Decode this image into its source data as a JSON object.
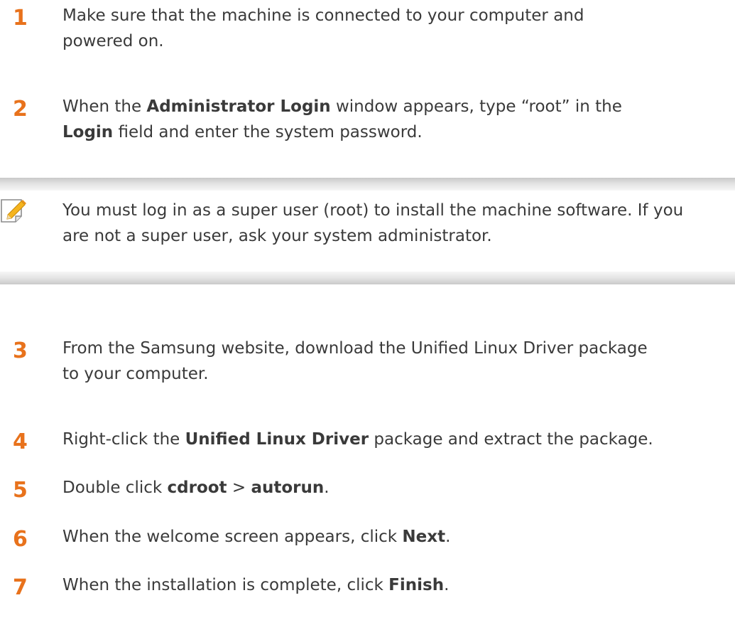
{
  "steps_top": [
    {
      "num": "1",
      "lines": [
        [
          {
            "t": "Make sure that the machine is connected to your computer and",
            "b": false
          }
        ],
        [
          {
            "t": "powered on.",
            "b": false
          }
        ]
      ]
    },
    {
      "num": "2",
      "lines": [
        [
          {
            "t": "When the ",
            "b": false
          },
          {
            "t": "Administrator Login",
            "b": true
          },
          {
            "t": " window appears, type “root” in the",
            "b": false
          }
        ],
        [
          {
            "t": "Login",
            "b": true
          },
          {
            "t": " field and enter the system password.",
            "b": false
          }
        ]
      ]
    }
  ],
  "note": {
    "icon": "note-pencil-icon",
    "accent": "#f5b41e",
    "lines": [
      "You must log in as a super user (root) to install the machine software. If you",
      "are not a super user, ask your system administrator."
    ]
  },
  "steps_bottom": [
    {
      "num": "3",
      "lines": [
        [
          {
            "t": "From the Samsung website, download the Unified Linux Driver package",
            "b": false
          }
        ],
        [
          {
            "t": "to your computer.",
            "b": false
          }
        ]
      ]
    },
    {
      "num": "4",
      "lines": [
        [
          {
            "t": "Right-click the ",
            "b": false
          },
          {
            "t": "Unified Linux Driver",
            "b": true
          },
          {
            "t": " package and extract the package.",
            "b": false
          }
        ]
      ]
    },
    {
      "num": "5",
      "lines": [
        [
          {
            "t": "Double click ",
            "b": false
          },
          {
            "t": "cdroot",
            "b": true
          },
          {
            "t": " > ",
            "b": false
          },
          {
            "t": "autorun",
            "b": true
          },
          {
            "t": ".",
            "b": false
          }
        ]
      ]
    },
    {
      "num": "6",
      "lines": [
        [
          {
            "t": "When the welcome screen appears, click ",
            "b": false
          },
          {
            "t": "Next",
            "b": true
          },
          {
            "t": ".",
            "b": false
          }
        ]
      ]
    },
    {
      "num": "7",
      "lines": [
        [
          {
            "t": "When the installation is complete, click ",
            "b": false
          },
          {
            "t": "Finish",
            "b": true
          },
          {
            "t": ".",
            "b": false
          }
        ]
      ]
    }
  ],
  "colors": {
    "step_number": "#e8721c",
    "body_text": "#3a3a3a",
    "note_bar": "#c9c9c9"
  }
}
